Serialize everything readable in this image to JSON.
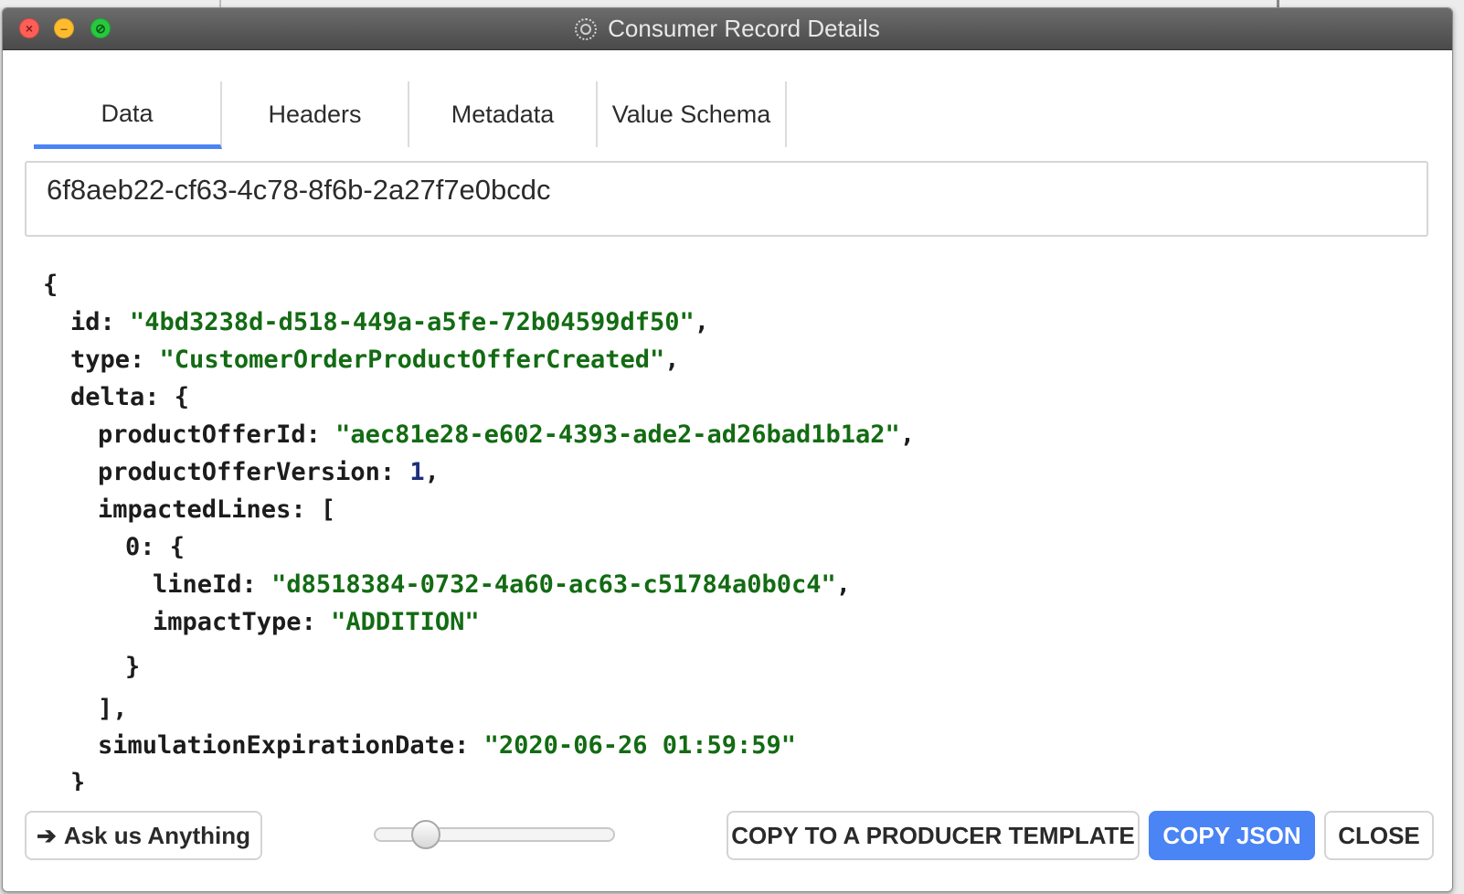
{
  "window": {
    "title": "Consumer Record Details"
  },
  "tabs": [
    {
      "label": "Data",
      "active": true
    },
    {
      "label": "Headers",
      "active": false
    },
    {
      "label": "Metadata",
      "active": false
    },
    {
      "label": "Value Schema",
      "active": false
    }
  ],
  "record_key": "6f8aeb22-cf63-4c78-8f6b-2a27f7e0bcdc",
  "json_view": {
    "open_brace": "{",
    "id_key": "id",
    "id_value": "\"4bd3238d-d518-449a-a5fe-72b04599df50\"",
    "type_key": "type",
    "type_value": "\"CustomerOrderProductOfferCreated\"",
    "delta_key": "delta",
    "productOfferId_key": "productOfferId",
    "productOfferId_value": "\"aec81e28-e602-4393-ade2-ad26bad1b1a2\"",
    "productOfferVersion_key": "productOfferVersion",
    "productOfferVersion_value": "1",
    "impactedLines_key": "impactedLines",
    "index_0_key": "0",
    "lineId_key": "lineId",
    "lineId_value": "\"d8518384-0732-4a60-ac63-c51784a0b0c4\"",
    "impactType_key": "impactType",
    "impactType_value": "\"ADDITION\"",
    "close_obj": "}",
    "close_arr": "],",
    "simulationExpirationDate_key": "simulationExpirationDate",
    "simulationExpirationDate_value": "\"2020-06-26 01:59:59\"",
    "close_delta_partial": "}"
  },
  "footer": {
    "ask_label": "Ask us Anything",
    "ask_icon": "arrow-right-icon",
    "zoom_slider_level": 0.2,
    "copy_template_label": "COPY TO A PRODUCER TEMPLATE",
    "copy_json_label": "COPY JSON",
    "close_label": "CLOSE"
  },
  "colors": {
    "accent": "#4a84f5",
    "string": "#136b13",
    "number": "#1c2e7c"
  }
}
